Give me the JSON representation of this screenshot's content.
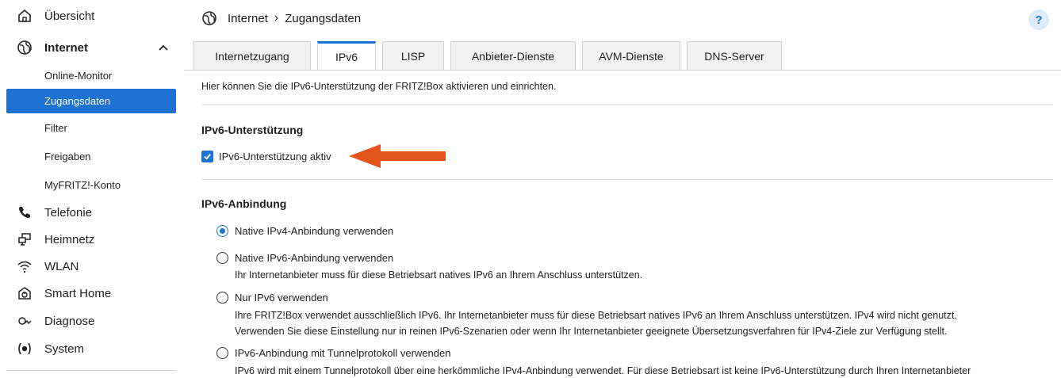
{
  "sidebar": {
    "overview": "Übersicht",
    "internet": "Internet",
    "internet_sub": [
      "Online-Monitor",
      "Zugangsdaten",
      "Filter",
      "Freigaben",
      "MyFRITZ!-Konto"
    ],
    "telefonie": "Telefonie",
    "heimnetz": "Heimnetz",
    "wlan": "WLAN",
    "smarthome": "Smart Home",
    "diagnose": "Diagnose",
    "system": "System"
  },
  "header": {
    "crumb1": "Internet",
    "crumb_sep": "›",
    "crumb2": "Zugangsdaten",
    "help": "?"
  },
  "tabs": [
    "Internetzugang",
    "IPv6",
    "LISP",
    "Anbieter-Dienste",
    "AVM-Dienste",
    "DNS-Server"
  ],
  "content": {
    "intro": "Hier können Sie die IPv6-Unterstützung der FRITZ!Box aktivieren und einrichten.",
    "support_title": "IPv6-Unterstützung",
    "support_checkbox": "IPv6-Unterstützung aktiv",
    "binding_title": "IPv6-Anbindung",
    "options": [
      {
        "label": "Native IPv4-Anbindung verwenden",
        "checked": true
      },
      {
        "label": "Native IPv6-Anbindung verwenden",
        "desc": "Ihr Internetanbieter muss für diese Betriebsart natives IPv6 an Ihrem Anschluss unterstützen."
      },
      {
        "label": "Nur IPv6 verwenden",
        "desc1": "Ihre FRITZ!Box verwendet ausschließlich IPv6. Ihr Internetanbieter muss für diese Betriebsart natives IPv6 an Ihrem Anschluss unterstützen. IPv4 wird nicht genutzt.",
        "desc2": "Verwenden Sie diese Einstellung nur in reinen IPv6-Szenarien oder wenn Ihr Internetanbieter geeignete Übersetzungsverfahren für IPv4-Ziele zur Verfügung stellt."
      },
      {
        "label": "IPv6-Anbindung mit Tunnelprotokoll verwenden",
        "desc": "IPv6 wird mit einem Tunnelprotokoll über eine herkömmliche IPv4-Anbindung verwendet. Für diese Betriebsart ist keine IPv6-Unterstützung durch Ihren Internetanbieter"
      }
    ]
  },
  "colors": {
    "accent": "#1e73d2",
    "arrow": "#e2541c"
  }
}
